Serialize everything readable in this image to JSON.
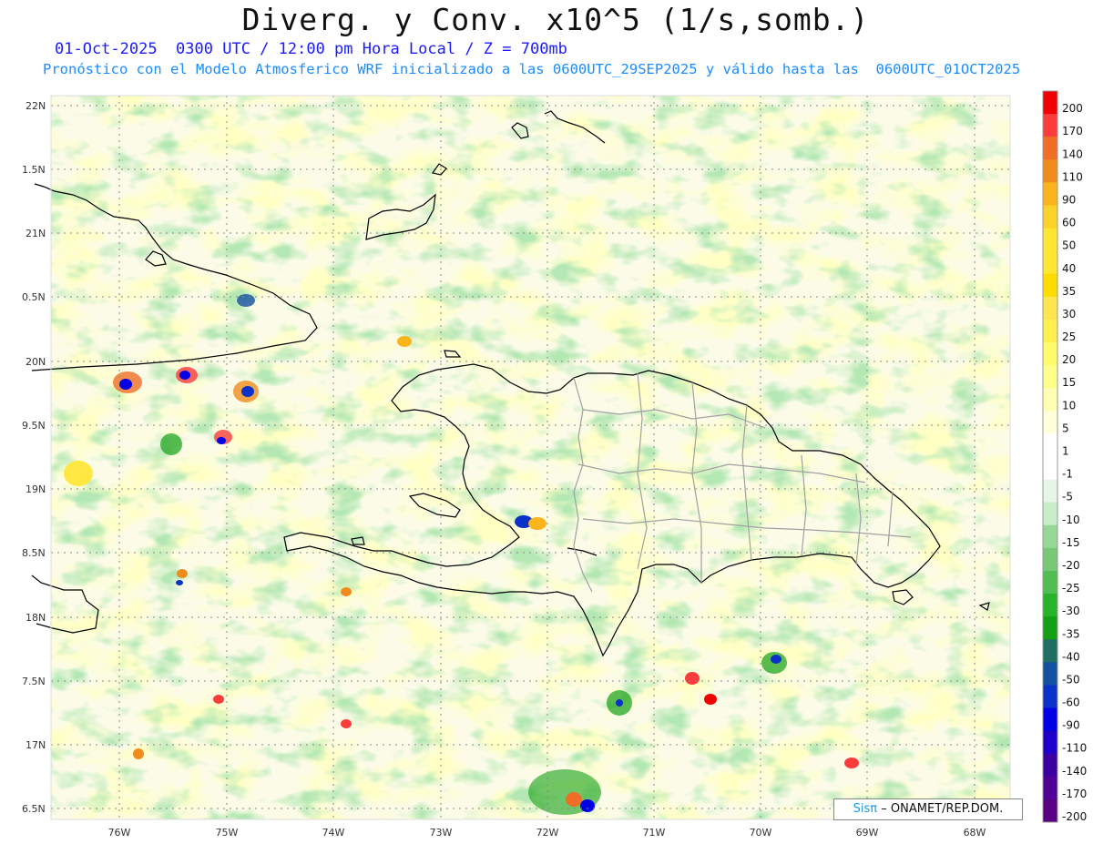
{
  "title": "Diverg. y Conv. x10^5 (1/s,somb.)",
  "subtitle_1": "01-Oct-2025  0300 UTC / 12:00 pm Hora Local / Z = 700mb",
  "subtitle_2": "Pronóstico con el Modelo Atmosferico WRF inicializado a las 0600UTC_29SEP2025 y válido hasta las  0600UTC_01OCT2025",
  "credit": {
    "logo": "Sisπ",
    "text": "– ONAMET/REP.DOM."
  },
  "lat_labels": [
    "22N",
    "1.5N",
    "21N",
    "0.5N",
    "20N",
    "9.5N",
    "19N",
    "8.5N",
    "18N",
    "7.5N",
    "17N",
    "6.5N"
  ],
  "lon_labels": [
    "76W",
    "75W",
    "74W",
    "73W",
    "72W",
    "71W",
    "70W",
    "69W",
    "68W"
  ],
  "colorbar": {
    "labels": [
      "200",
      "170",
      "140",
      "110",
      "90",
      "60",
      "50",
      "40",
      "35",
      "30",
      "25",
      "20",
      "15",
      "10",
      "5",
      "1",
      "-1",
      "-5",
      "-10",
      "-15",
      "-20",
      "-25",
      "-30",
      "-35",
      "-40",
      "-50",
      "-60",
      "-90",
      "-110",
      "-140",
      "-170",
      "-200"
    ],
    "colors": [
      "#f00000",
      "#fa3c3c",
      "#f06e28",
      "#f08c1e",
      "#fab41e",
      "#fad228",
      "#ffe632",
      "#ffe632",
      "#ffdc00",
      "#ffe650",
      "#fff050",
      "#fffa6e",
      "#ffff8c",
      "#ffffb4",
      "#ffffdc",
      "#ffffff",
      "#ffffff",
      "#e6f5e6",
      "#c8ebc8",
      "#96d796",
      "#78c878",
      "#50be50",
      "#28b428",
      "#14a014",
      "#1e6e64",
      "#1450a0",
      "#0a32c8",
      "#0000e6",
      "#1e00c8",
      "#3c00a0",
      "#500096",
      "#5a0082"
    ]
  },
  "colors": {
    "land_outline": "#000000",
    "province_lines": "#a0a0a0",
    "title": "#111111",
    "subtitle1": "#1a1aff",
    "subtitle2": "#1a8cff"
  }
}
